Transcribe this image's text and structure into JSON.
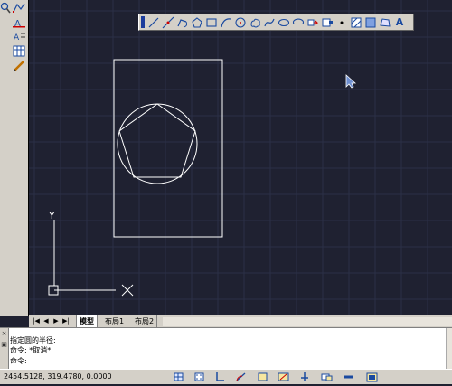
{
  "left_toolbar": {
    "tools": [
      "zoom-icon",
      "polyline-tool-icon",
      "text-tool-icon",
      "multiline-text-icon",
      "table-tool-icon",
      "pencil-tool-icon"
    ]
  },
  "draw_toolbar": {
    "buttons": [
      "line-icon",
      "construction-line-icon",
      "polyline-icon",
      "polygon-icon",
      "rectangle-icon",
      "arc-icon",
      "circle-icon",
      "revision-cloud-icon",
      "spline-icon",
      "ellipse-icon",
      "ellipse-arc-icon",
      "insert-block-icon",
      "make-block-icon",
      "point-icon",
      "hatch-icon",
      "gradient-icon",
      "region-icon",
      "multiline-text-icon"
    ],
    "text_button_label": "A"
  },
  "tabs": {
    "model": "模型",
    "layout1": "布局1",
    "layout2": "布局2"
  },
  "ucs": {
    "y_label": "Y",
    "x_label": "X"
  },
  "command": {
    "line1": "指定圆的半径:",
    "line2": "命令: *取消*",
    "line3": "命令:"
  },
  "status": {
    "coordinates": "2454.5128, 319.4780, 0.0000",
    "toggles": [
      "snap-icon",
      "grid-icon",
      "ortho-icon",
      "polar-icon",
      "osnap-icon",
      "otrack-icon",
      "ducs-icon",
      "dyn-icon",
      "lwt-icon",
      "model-icon"
    ]
  },
  "colors": {
    "canvas_bg": "#1f2131",
    "grid_line": "#2b3046",
    "geometry": "#ffffff",
    "panel": "#d4d0c8"
  }
}
